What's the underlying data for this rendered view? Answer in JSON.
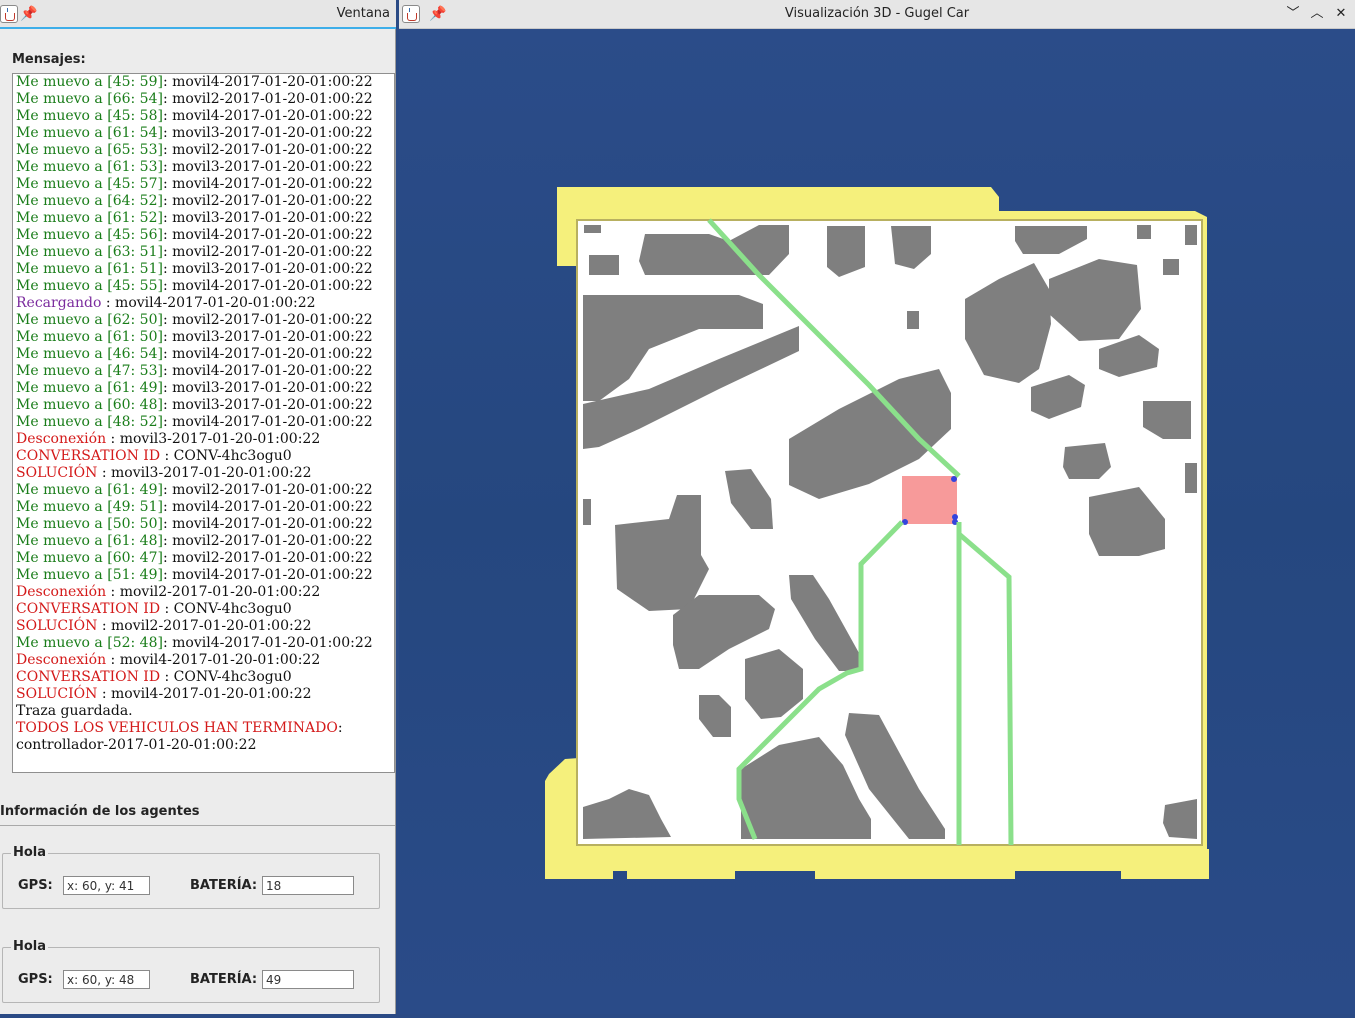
{
  "left_window": {
    "title": "Ventana",
    "pin_icon": "pin-icon",
    "messages_label": "Mensajes:",
    "log": [
      {
        "kind": "move",
        "head": "Me muevo a [45: 59]",
        "tail": ": movil4-2017-01-20-01:00:22"
      },
      {
        "kind": "move",
        "head": "Me muevo a [66: 54]",
        "tail": ": movil2-2017-01-20-01:00:22"
      },
      {
        "kind": "move",
        "head": "Me muevo a [45: 58]",
        "tail": ": movil4-2017-01-20-01:00:22"
      },
      {
        "kind": "move",
        "head": "Me muevo a [61: 54]",
        "tail": ": movil3-2017-01-20-01:00:22"
      },
      {
        "kind": "move",
        "head": "Me muevo a [65: 53]",
        "tail": ": movil2-2017-01-20-01:00:22"
      },
      {
        "kind": "move",
        "head": "Me muevo a [61: 53]",
        "tail": ": movil3-2017-01-20-01:00:22"
      },
      {
        "kind": "move",
        "head": "Me muevo a [45: 57]",
        "tail": ": movil4-2017-01-20-01:00:22"
      },
      {
        "kind": "move",
        "head": "Me muevo a [64: 52]",
        "tail": ": movil2-2017-01-20-01:00:22"
      },
      {
        "kind": "move",
        "head": "Me muevo a [61: 52]",
        "tail": ": movil3-2017-01-20-01:00:22"
      },
      {
        "kind": "move",
        "head": "Me muevo a [45: 56]",
        "tail": ": movil4-2017-01-20-01:00:22"
      },
      {
        "kind": "move",
        "head": "Me muevo a [63: 51]",
        "tail": ": movil2-2017-01-20-01:00:22"
      },
      {
        "kind": "move",
        "head": "Me muevo a [61: 51]",
        "tail": ": movil3-2017-01-20-01:00:22"
      },
      {
        "kind": "move",
        "head": "Me muevo a [45: 55]",
        "tail": ": movil4-2017-01-20-01:00:22"
      },
      {
        "kind": "reload",
        "head": "Recargando",
        "tail": " : movil4-2017-01-20-01:00:22"
      },
      {
        "kind": "move",
        "head": "Me muevo a [62: 50]",
        "tail": ": movil2-2017-01-20-01:00:22"
      },
      {
        "kind": "move",
        "head": "Me muevo a [61: 50]",
        "tail": ": movil3-2017-01-20-01:00:22"
      },
      {
        "kind": "move",
        "head": "Me muevo a [46: 54]",
        "tail": ": movil4-2017-01-20-01:00:22"
      },
      {
        "kind": "move",
        "head": "Me muevo a [47: 53]",
        "tail": ": movil4-2017-01-20-01:00:22"
      },
      {
        "kind": "move",
        "head": "Me muevo a [61: 49]",
        "tail": ": movil3-2017-01-20-01:00:22"
      },
      {
        "kind": "move",
        "head": "Me muevo a [60: 48]",
        "tail": ": movil3-2017-01-20-01:00:22"
      },
      {
        "kind": "move",
        "head": "Me muevo a [48: 52]",
        "tail": ": movil4-2017-01-20-01:00:22"
      },
      {
        "kind": "red",
        "head": "Desconexión",
        "tail": " : movil3-2017-01-20-01:00:22"
      },
      {
        "kind": "red",
        "head": "CONVERSATION ID",
        "tail": " : CONV-4hc3ogu0"
      },
      {
        "kind": "red",
        "head": "SOLUCIÓN",
        "tail": " : movil3-2017-01-20-01:00:22"
      },
      {
        "kind": "move",
        "head": "Me muevo a [61: 49]",
        "tail": ": movil2-2017-01-20-01:00:22"
      },
      {
        "kind": "move",
        "head": "Me muevo a [49: 51]",
        "tail": ": movil4-2017-01-20-01:00:22"
      },
      {
        "kind": "move",
        "head": "Me muevo a [50: 50]",
        "tail": ": movil4-2017-01-20-01:00:22"
      },
      {
        "kind": "move",
        "head": "Me muevo a [61: 48]",
        "tail": ": movil2-2017-01-20-01:00:22"
      },
      {
        "kind": "move",
        "head": "Me muevo a [60: 47]",
        "tail": ": movil2-2017-01-20-01:00:22"
      },
      {
        "kind": "move",
        "head": "Me muevo a [51: 49]",
        "tail": ": movil4-2017-01-20-01:00:22"
      },
      {
        "kind": "red",
        "head": "Desconexión",
        "tail": " : movil2-2017-01-20-01:00:22"
      },
      {
        "kind": "red",
        "head": "CONVERSATION ID",
        "tail": " : CONV-4hc3ogu0"
      },
      {
        "kind": "red",
        "head": "SOLUCIÓN",
        "tail": " : movil2-2017-01-20-01:00:22"
      },
      {
        "kind": "move",
        "head": "Me muevo a [52: 48]",
        "tail": ": movil4-2017-01-20-01:00:22"
      },
      {
        "kind": "red",
        "head": "Desconexión",
        "tail": " : movil4-2017-01-20-01:00:22"
      },
      {
        "kind": "red",
        "head": "CONVERSATION ID",
        "tail": " : CONV-4hc3ogu0"
      },
      {
        "kind": "red",
        "head": "SOLUCIÓN",
        "tail": " : movil4-2017-01-20-01:00:22"
      },
      {
        "kind": "plain",
        "head": "",
        "tail": "Traza guardada."
      },
      {
        "kind": "red",
        "head": "TODOS LOS VEHICULOS HAN TERMINADO",
        "tail": ":"
      },
      {
        "kind": "plain",
        "head": "",
        "tail": "controllador-2017-01-20-01:00:22"
      }
    ],
    "agents_heading": "Información de los agentes",
    "agents": [
      {
        "title": "Hola",
        "gps_label": "GPS:",
        "gps_value": "x: 60, y: 41",
        "battery_label": "BATERÍA:",
        "battery_value": "18"
      },
      {
        "title": "Hola",
        "gps_label": "GPS:",
        "gps_value": "x: 60, y: 48",
        "battery_label": "BATERÍA:",
        "battery_value": "49"
      }
    ]
  },
  "right_window": {
    "title": "Visualización 3D - Gugel Car",
    "pin_icon": "pin-icon",
    "buttons": {
      "minimize": "﹀",
      "maximize": "︿",
      "close": "✕"
    }
  },
  "colors": {
    "move": "#1a7d1a",
    "reload": "#7b2b9e",
    "alert": "#d41a1a",
    "obstacle": "#7f7f7f",
    "path": "#8be08b",
    "goal": "#f79a9a",
    "border": "#f5f07c",
    "sky": "#2a4a85"
  }
}
